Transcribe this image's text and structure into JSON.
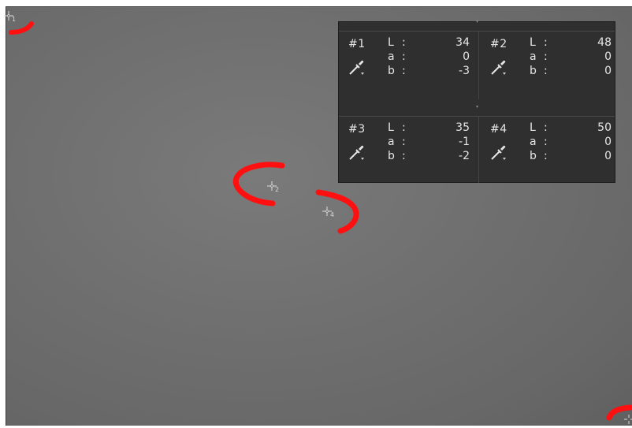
{
  "samplers": [
    {
      "number": "1"
    },
    {
      "number": "2"
    },
    {
      "number": "4"
    }
  ],
  "info_panel": {
    "cells": [
      {
        "id": "#1",
        "rows": [
          {
            "label": "L",
            "value": "34"
          },
          {
            "label": "a",
            "value": "0"
          },
          {
            "label": "b",
            "value": "-3"
          }
        ]
      },
      {
        "id": "#2",
        "rows": [
          {
            "label": "L",
            "value": "48"
          },
          {
            "label": "a",
            "value": "0"
          },
          {
            "label": "b",
            "value": "0"
          }
        ]
      },
      {
        "id": "#3",
        "rows": [
          {
            "label": "L",
            "value": "35"
          },
          {
            "label": "a",
            "value": "-1"
          },
          {
            "label": "b",
            "value": "-2"
          }
        ]
      },
      {
        "id": "#4",
        "rows": [
          {
            "label": "L",
            "value": "50"
          },
          {
            "label": "a",
            "value": "0"
          },
          {
            "label": "b",
            "value": "0"
          }
        ]
      }
    ],
    "colon": ":"
  },
  "colors": {
    "canvas": "#707070",
    "panel_bg": "#2f2f2f",
    "panel_text": "#e6e6e6",
    "annotation": "#ff1010"
  },
  "icons": {
    "sampler": "color-sampler-crosshair-icon",
    "eyedropper": "eyedropper-icon"
  }
}
